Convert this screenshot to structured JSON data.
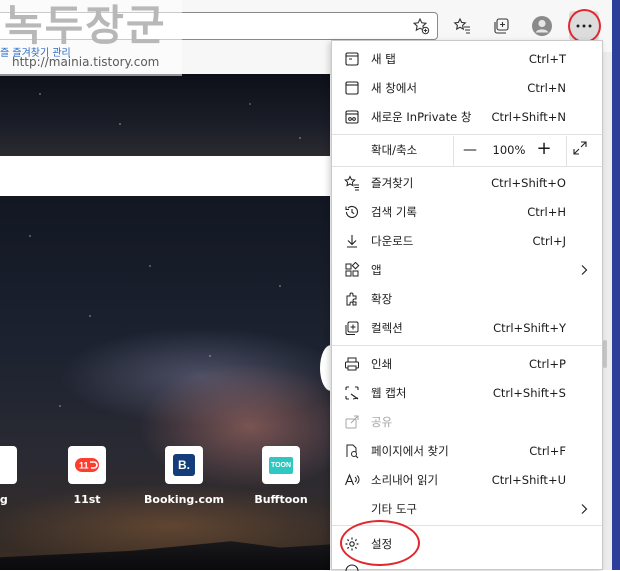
{
  "watermark": {
    "title": "녹두장군",
    "url": "http://mainia.tistory.com"
  },
  "favorites_bar": {
    "partial_link": "즐 즐겨찾기 관리"
  },
  "toolbar": {
    "add_favorite_icon": "star-plus-icon",
    "favorites_icon": "favorites-icon",
    "collections_icon": "collections-icon",
    "profile_icon": "profile-icon",
    "more_icon": "ellipsis-icon"
  },
  "new_tab": {
    "tiles": [
      {
        "label": "ing",
        "icon": "partial-tile"
      },
      {
        "label": "11st",
        "icon": "11st-logo"
      },
      {
        "label": "Booking.com",
        "icon_text": "B.",
        "icon": "booking-logo"
      },
      {
        "label": "Bufftoon",
        "icon_text": "TOON",
        "icon": "bufftoon-logo"
      }
    ]
  },
  "menu": {
    "new_tab": {
      "label": "새 탭",
      "shortcut": "Ctrl+T"
    },
    "new_window": {
      "label": "새 창에서",
      "shortcut": "Ctrl+N"
    },
    "inprivate": {
      "label": "새로운 InPrivate 창",
      "shortcut": "Ctrl+Shift+N"
    },
    "zoom": {
      "label": "확대/축소",
      "value": "100%",
      "minus": "—",
      "plus": "+"
    },
    "favorites": {
      "label": "즐겨찾기",
      "shortcut": "Ctrl+Shift+O"
    },
    "history": {
      "label": "검색 기록",
      "shortcut": "Ctrl+H"
    },
    "downloads": {
      "label": "다운로드",
      "shortcut": "Ctrl+J"
    },
    "apps": {
      "label": "앱"
    },
    "extensions": {
      "label": "확장"
    },
    "collections": {
      "label": "컬렉션",
      "shortcut": "Ctrl+Shift+Y"
    },
    "print": {
      "label": "인쇄",
      "shortcut": "Ctrl+P"
    },
    "web_capture": {
      "label": "웹 캡처",
      "shortcut": "Ctrl+Shift+S"
    },
    "share": {
      "label": "공유"
    },
    "find": {
      "label": "페이지에서 찾기",
      "shortcut": "Ctrl+F"
    },
    "read_aloud": {
      "label": "소리내어 읽기",
      "shortcut": "Ctrl+Shift+U"
    },
    "more_tools": {
      "label": "기타 도구"
    },
    "settings": {
      "label": "설정"
    }
  },
  "colors": {
    "highlight_ring": "#e0282e",
    "menu_bg": "#ffffff",
    "accent_edge": "#2a3e9a"
  }
}
